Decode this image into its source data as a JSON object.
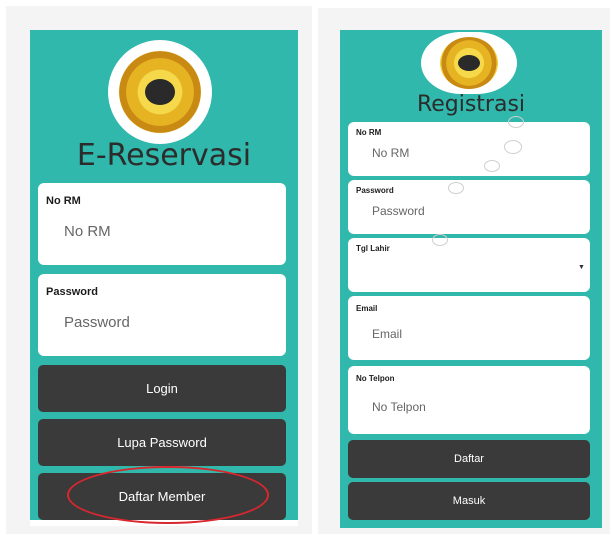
{
  "login": {
    "title": "E-Reservasi",
    "fields": [
      {
        "label": "No RM",
        "placeholder": "No RM"
      },
      {
        "label": "Password",
        "placeholder": "Password"
      }
    ],
    "buttons": {
      "login": "Login",
      "forgot": "Lupa Password",
      "register": "Daftar Member"
    },
    "logo_icon": "rs-emblem-logo"
  },
  "register": {
    "title": "Registrasi",
    "fields": [
      {
        "label": "No RM",
        "placeholder": "No RM"
      },
      {
        "label": "Password",
        "placeholder": "Password"
      },
      {
        "label": "Tgl Lahir",
        "placeholder": ""
      },
      {
        "label": "Email",
        "placeholder": "Email"
      },
      {
        "label": "No Telpon",
        "placeholder": "No Telpon"
      }
    ],
    "buttons": {
      "submit": "Daftar",
      "login": "Masuk"
    },
    "logo_icon": "rs-emblem-logo"
  },
  "colors": {
    "screen_bg": "#2fb8ab",
    "button_bg": "#3a3a3a",
    "highlight_circle": "#d9272e"
  }
}
